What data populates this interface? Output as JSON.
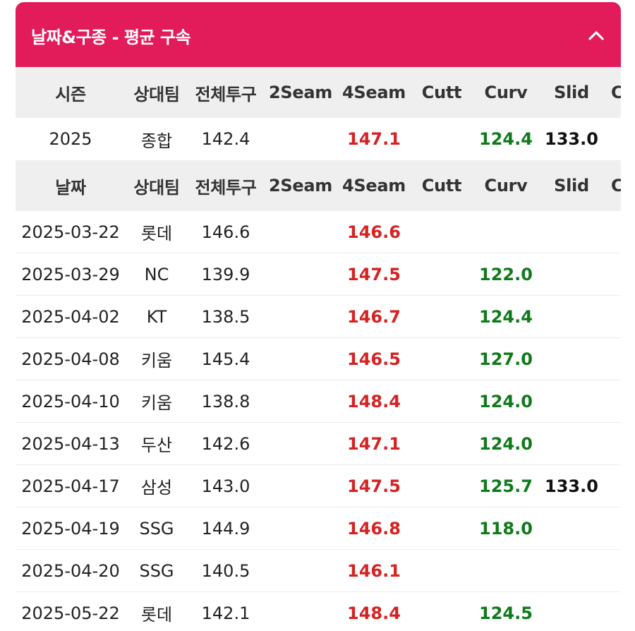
{
  "panel": {
    "title": "날짜&구종 - 평균 구속",
    "collapse_icon": "chevron-up-icon"
  },
  "season_header": [
    "시즌",
    "상대팀",
    "전체투구",
    "2Seam",
    "4Seam",
    "Cutt",
    "Curv",
    "Slid",
    "C"
  ],
  "season_row": {
    "season": "2025",
    "opponent": "종합",
    "total": "142.4",
    "seam2": "",
    "seam4": "147.1",
    "cutt": "",
    "curv": "124.4",
    "slid": "133.0",
    "c": ""
  },
  "date_header": [
    "날짜",
    "상대팀",
    "전체투구",
    "2Seam",
    "4Seam",
    "Cutt",
    "Curv",
    "Slid",
    "C"
  ],
  "rows": [
    {
      "date": "2025-03-22",
      "opponent": "롯데",
      "total": "146.6",
      "seam2": "",
      "seam4": "146.6",
      "cutt": "",
      "curv": "",
      "slid": ""
    },
    {
      "date": "2025-03-29",
      "opponent": "NC",
      "total": "139.9",
      "seam2": "",
      "seam4": "147.5",
      "cutt": "",
      "curv": "122.0",
      "slid": ""
    },
    {
      "date": "2025-04-02",
      "opponent": "KT",
      "total": "138.5",
      "seam2": "",
      "seam4": "146.7",
      "cutt": "",
      "curv": "124.4",
      "slid": ""
    },
    {
      "date": "2025-04-08",
      "opponent": "키움",
      "total": "145.4",
      "seam2": "",
      "seam4": "146.5",
      "cutt": "",
      "curv": "127.0",
      "slid": ""
    },
    {
      "date": "2025-04-10",
      "opponent": "키움",
      "total": "138.8",
      "seam2": "",
      "seam4": "148.4",
      "cutt": "",
      "curv": "124.0",
      "slid": ""
    },
    {
      "date": "2025-04-13",
      "opponent": "두산",
      "total": "142.6",
      "seam2": "",
      "seam4": "147.1",
      "cutt": "",
      "curv": "124.0",
      "slid": ""
    },
    {
      "date": "2025-04-17",
      "opponent": "삼성",
      "total": "143.0",
      "seam2": "",
      "seam4": "147.5",
      "cutt": "",
      "curv": "125.7",
      "slid": "133.0"
    },
    {
      "date": "2025-04-19",
      "opponent": "SSG",
      "total": "144.9",
      "seam2": "",
      "seam4": "146.8",
      "cutt": "",
      "curv": "118.0",
      "slid": ""
    },
    {
      "date": "2025-04-20",
      "opponent": "SSG",
      "total": "140.5",
      "seam2": "",
      "seam4": "146.1",
      "cutt": "",
      "curv": "",
      "slid": ""
    },
    {
      "date": "2025-05-22",
      "opponent": "롯데",
      "total": "142.1",
      "seam2": "",
      "seam4": "148.4",
      "cutt": "",
      "curv": "124.5",
      "slid": ""
    }
  ],
  "colors": {
    "header_bg": "#e21c5b",
    "fastball": "#d62222",
    "curve": "#0f7a1a",
    "slider": "#111111"
  }
}
